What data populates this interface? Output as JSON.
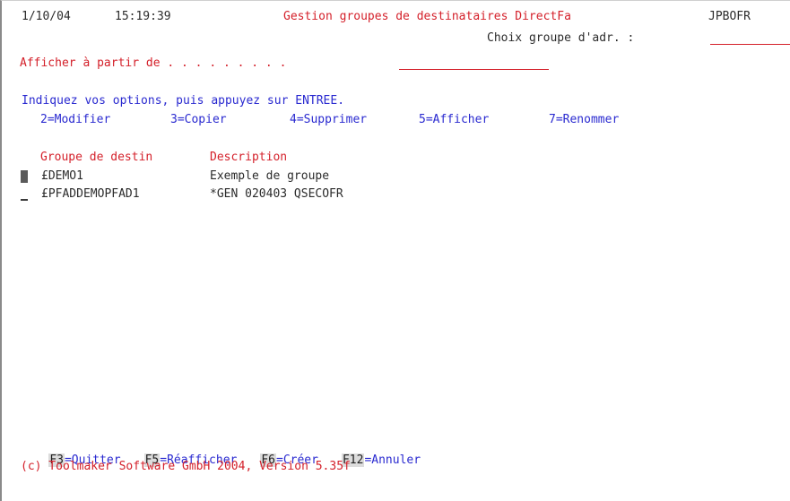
{
  "header": {
    "date": "1/10/04",
    "time": "15:19:39",
    "title": "Gestion groupes de destinataires DirectFa",
    "system": "JPBOFR",
    "choix_label": "Choix groupe d'adr. :"
  },
  "position_prompt": {
    "label": "Afficher à partir de . . . . . . . . .",
    "value": ""
  },
  "instructions": "Indiquez vos options, puis appuyez sur ENTREE.",
  "options": [
    "2=Modifier",
    "3=Copier",
    "4=Supprimer",
    "5=Afficher",
    "7=Renommer"
  ],
  "columns": {
    "group": "Groupe de destin",
    "description": "Description"
  },
  "rows": [
    {
      "option": "",
      "group": "£DEMO1",
      "description": "Exemple de groupe"
    },
    {
      "option": "",
      "group": "£PFADDEMOPFAD1",
      "description": "*GEN 020403 QSECOFR"
    }
  ],
  "function_keys": [
    {
      "key": "F3",
      "label": "=Quitter"
    },
    {
      "key": "F5",
      "label": "=Réafficher"
    },
    {
      "key": "F6",
      "label": "=Créer"
    },
    {
      "key": "F12",
      "label": "=Annuler"
    }
  ],
  "copyright": "(c) Toolmaker Software GmbH 2004, Version 5.35f",
  "colors": {
    "text": "#2b2b2b",
    "field_label": "#d4202a",
    "info": "#2a2ad0",
    "background": "#ffffff"
  }
}
